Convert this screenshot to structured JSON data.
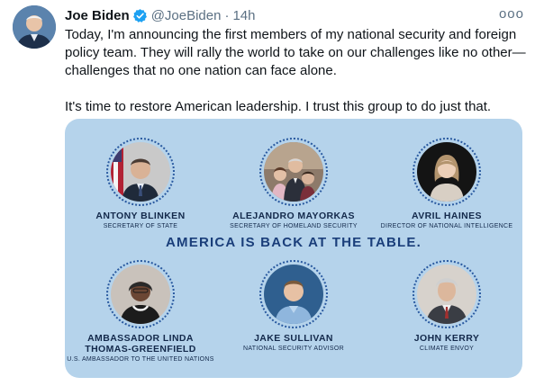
{
  "tweet": {
    "author_name": "Joe Biden",
    "handle": "@JoeBiden",
    "separator": "·",
    "time": "14h",
    "more_label": "ooo",
    "paragraph1": "Today, I'm announcing the first members of my national security and foreign policy team. They will rally the world to take on our challenges like no other—challenges that no one nation can face alone.",
    "paragraph2": "It's time to restore American leadership. I trust this group to do just that."
  },
  "card": {
    "headline": "AMERICA IS BACK AT THE TABLE.",
    "people": [
      {
        "name": "ANTONY BLINKEN",
        "role": "SECRETARY OF STATE"
      },
      {
        "name": "ALEJANDRO MAYORKAS",
        "role": "SECRETARY OF HOMELAND SECURITY"
      },
      {
        "name": "AVRIL HAINES",
        "role": "DIRECTOR OF NATIONAL INTELLIGENCE"
      },
      {
        "name": "AMBASSADOR LINDA THOMAS-GREENFIELD",
        "role": "U.S. AMBASSADOR TO THE UNITED NATIONS"
      },
      {
        "name": "JAKE SULLIVAN",
        "role": "NATIONAL SECURITY ADVISOR"
      },
      {
        "name": "JOHN KERRY",
        "role": "CLIMATE ENVOY"
      }
    ]
  },
  "colors": {
    "card_background": "#b5d3eb",
    "headline_text": "#1a3e7a",
    "verified_badge": "#1da1f2"
  }
}
